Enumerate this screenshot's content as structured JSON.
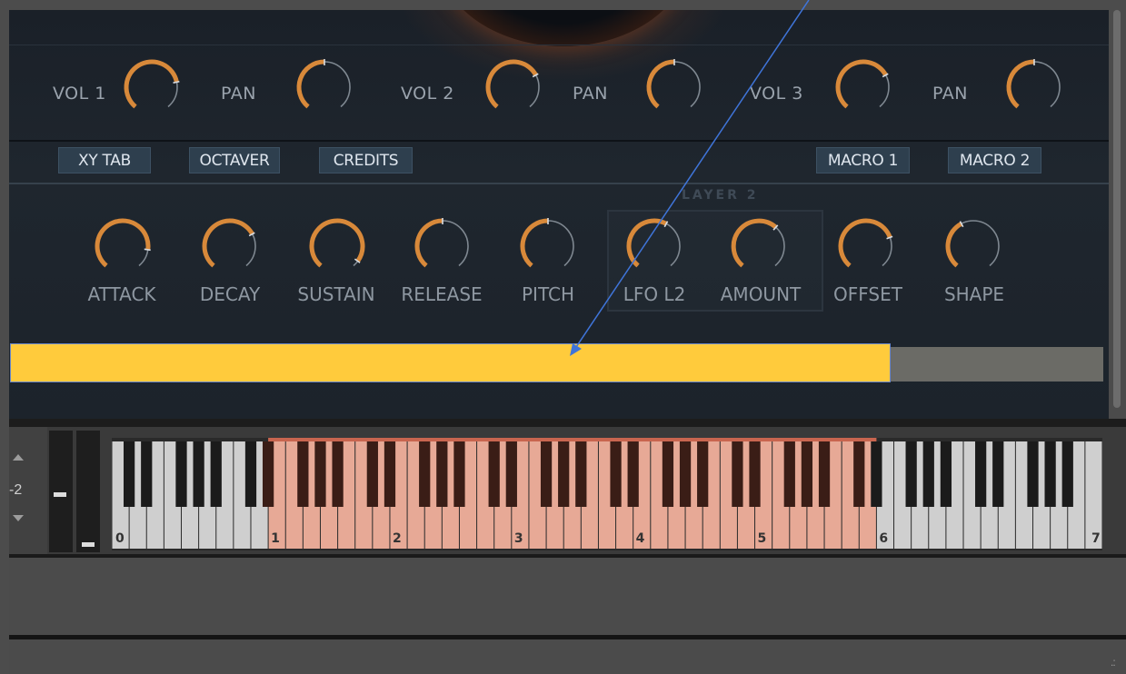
{
  "mixer": {
    "vol1": "VOL 1",
    "pan1": "PAN",
    "vol2": "VOL 2",
    "pan2": "PAN",
    "vol3": "VOL 3",
    "pan3": "PAN"
  },
  "tabs": {
    "xytab": "XY TAB",
    "octaver": "OCTAVER",
    "credits": "CREDITS",
    "macro1": "MACRO 1",
    "macro2": "MACRO 2"
  },
  "layer": {
    "title": "LAYER 2"
  },
  "envelope": {
    "attack": "ATTACK",
    "decay": "DECAY",
    "sustain": "SUSTAIN",
    "release": "RELEASE",
    "pitch": "PITCH",
    "lfo": "LFO L2",
    "amount": "AMOUNT",
    "offset": "OFFSET",
    "shape": "SHAPE"
  },
  "keyboard": {
    "octave_shift": "-2",
    "octave_labels": [
      "0",
      "1",
      "2",
      "3",
      "4",
      "5",
      "6",
      "7"
    ]
  },
  "colors": {
    "knob_accent": "#d8893a",
    "tab_bg": "#2e3f4e",
    "highlight_bar": "#ffcb3c",
    "key_range": "#e7a996",
    "annotation_arrow": "#3f74d8"
  },
  "icons": {
    "octave_up": "triangle-up-icon",
    "octave_down": "triangle-down-icon",
    "resize": "resize-grip-icon"
  }
}
